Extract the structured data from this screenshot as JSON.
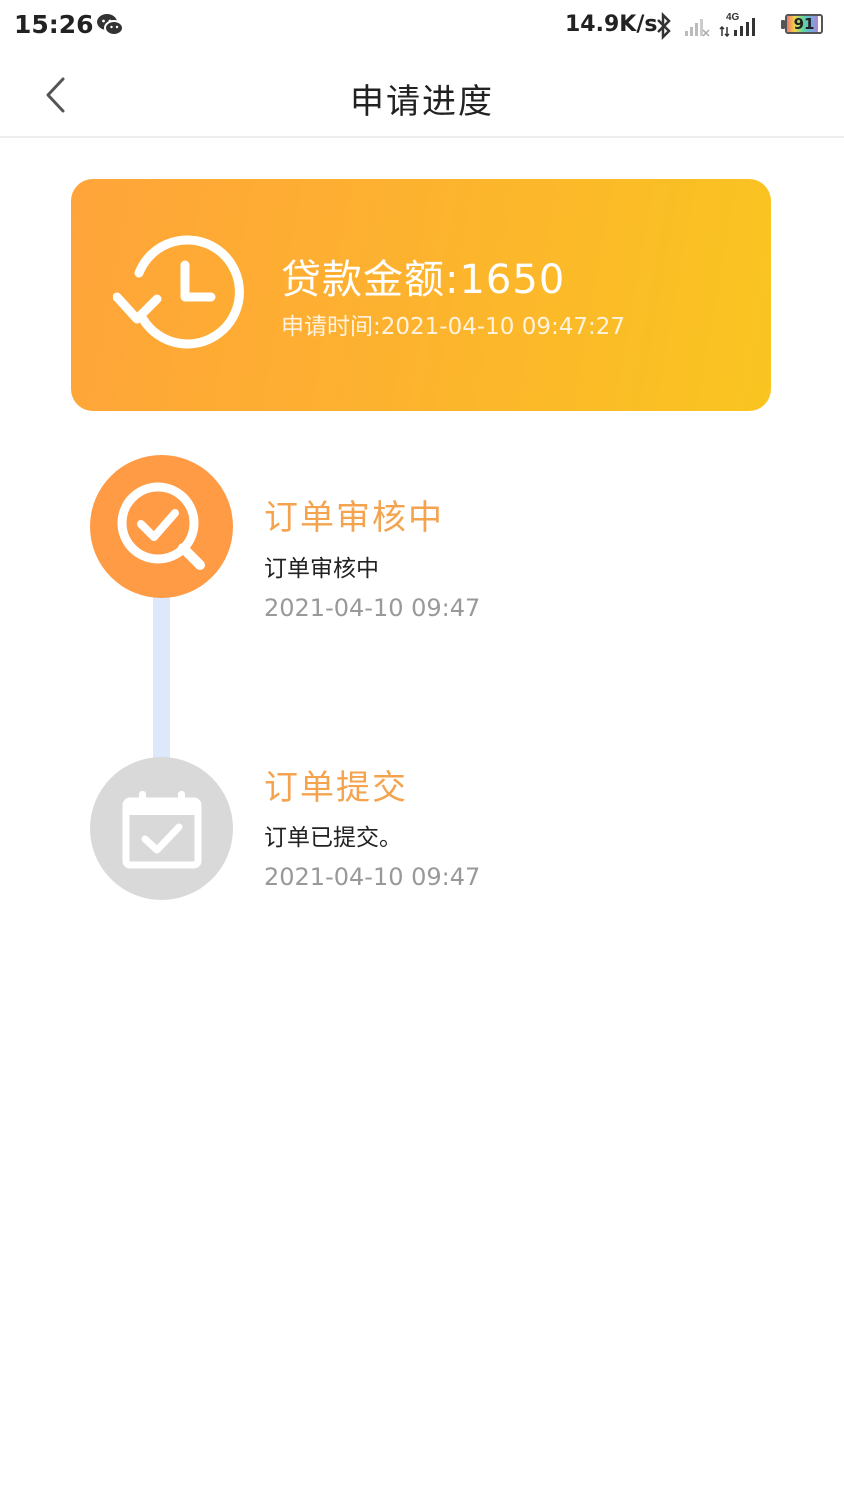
{
  "status_bar": {
    "time": "15:26",
    "network_speed": "14.9K/s",
    "network_type": "4G",
    "battery_level": "91",
    "icons": [
      "wechat-icon",
      "bluetooth-icon",
      "signal-sim1-icon",
      "signal-sim2-icon",
      "battery-icon"
    ]
  },
  "nav": {
    "title": "申请进度",
    "back_icon": "chevron-left-icon"
  },
  "summary": {
    "amount_text": "贷款金额:1650",
    "apply_time_text": "申请时间:2021-04-10 09:47:27",
    "icon": "history-clock-icon"
  },
  "steps": [
    {
      "title": "订单审核中",
      "description": "订单审核中",
      "time": "2021-04-10 09:47",
      "icon": "search-check-icon",
      "status_color": "#ff9a45"
    },
    {
      "title": "订单提交",
      "description": "订单已提交。",
      "time": "2021-04-10 09:47",
      "icon": "calendar-check-icon",
      "status_color": "#d9d9d9"
    }
  ],
  "colors": {
    "accent": "#f4a34f",
    "card_gradient_start": "#ffa43a",
    "card_gradient_end": "#f9c520",
    "connector": "#dde8fb"
  }
}
